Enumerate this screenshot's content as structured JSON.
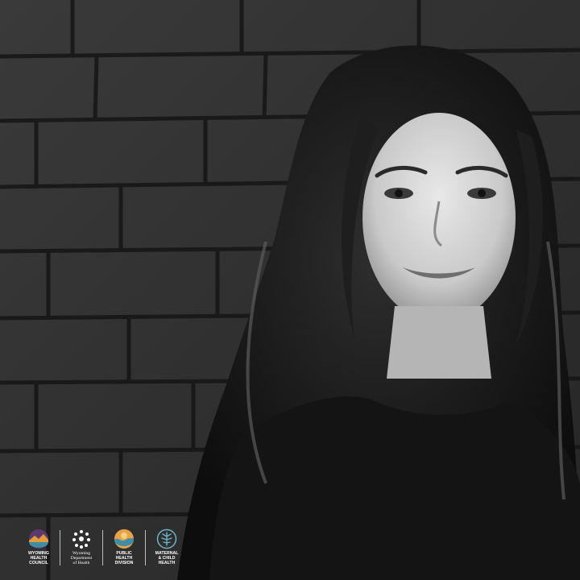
{
  "photo": {
    "alt_subject": "portrait",
    "tone": "black-and-white"
  },
  "logos": [
    {
      "icon": "landscape-circle-icon",
      "lines": [
        "WYOMING",
        "HEALTH",
        "COUNCIL"
      ],
      "color": "#c9a04a"
    },
    {
      "icon": "people-circle-icon",
      "lines": [
        "Wyoming",
        "Department",
        "of Health"
      ],
      "color": "#ffffff"
    },
    {
      "icon": "wave-sun-circle-icon",
      "lines": [
        "PUBLIC",
        "HEALTH",
        "DIVISION"
      ],
      "color": "#d98a3a"
    },
    {
      "icon": "tree-circle-icon",
      "lines": [
        "MATERNAL",
        "& CHILD",
        "HEALTH"
      ],
      "color": "#6fb3c8"
    }
  ]
}
